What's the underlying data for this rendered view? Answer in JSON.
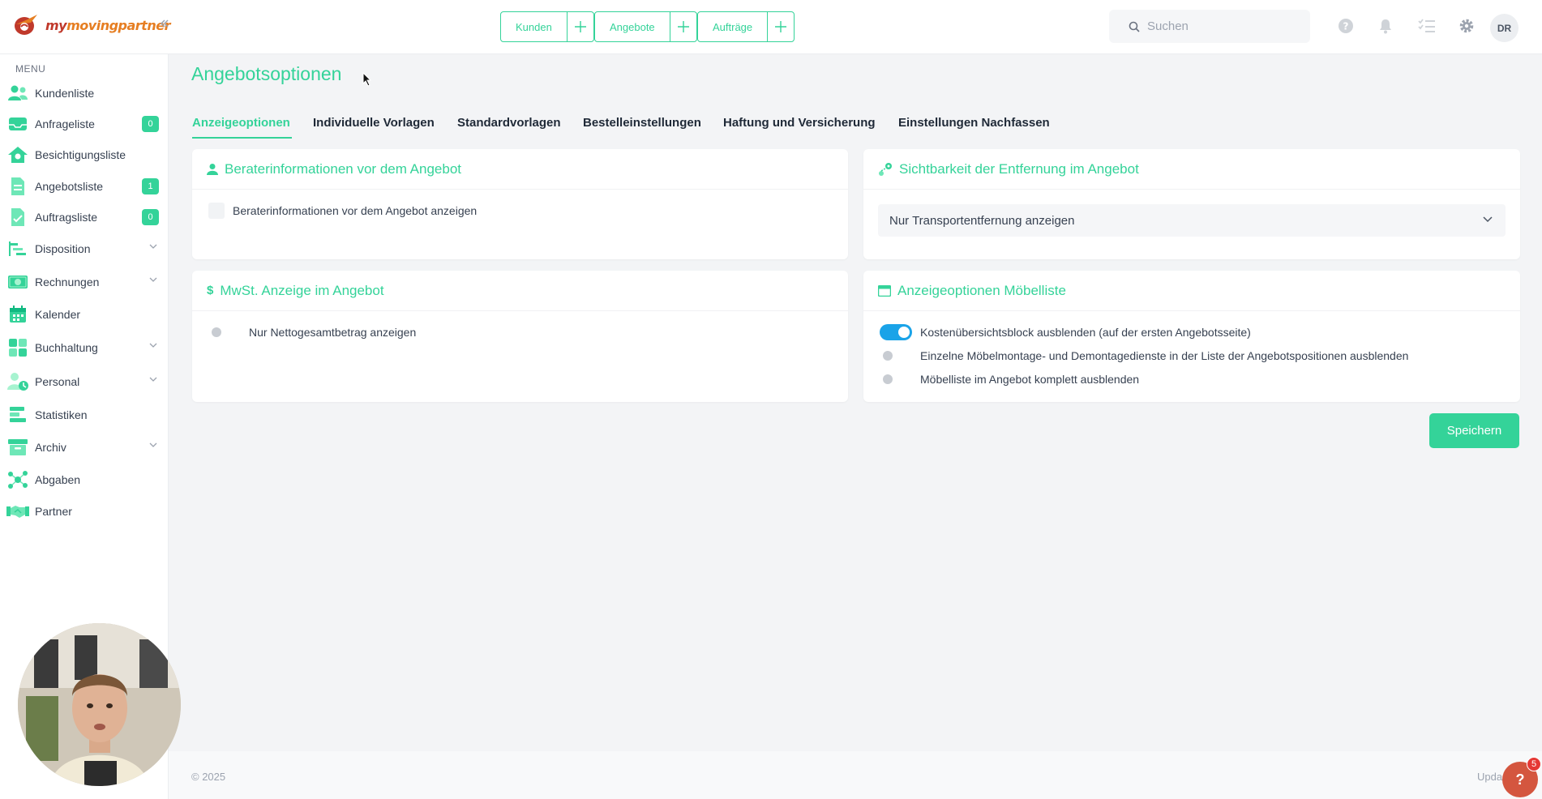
{
  "colors": {
    "accent": "#34d399",
    "toggle_on": "#1aa3e8",
    "brand_red": "#c0392b",
    "brand_orange": "#e67e22",
    "help": "#d4563f"
  },
  "header": {
    "logo_part1": "my",
    "logo_part2": "movingpartner",
    "quick_nav": [
      {
        "label": "Kunden",
        "plus_icon": "plus-icon"
      },
      {
        "label": "Angebote",
        "plus_icon": "plus-icon"
      },
      {
        "label": "Aufträge",
        "plus_icon": "plus-icon"
      }
    ],
    "search_placeholder": "Suchen",
    "icons": [
      "help-icon",
      "bell-icon",
      "task-list-icon",
      "gear-icon"
    ],
    "avatar_initials": "DR"
  },
  "sidebar": {
    "menu_label": "MENU",
    "items": [
      {
        "label": "Kundenliste",
        "icon": "customers-icon"
      },
      {
        "label": "Anfrageliste",
        "icon": "inbox-icon",
        "badge": "0"
      },
      {
        "label": "Besichtigungsliste",
        "icon": "house-icon"
      },
      {
        "label": "Angebotsliste",
        "icon": "document-icon",
        "badge": "1"
      },
      {
        "label": "Auftragsliste",
        "icon": "document-icon",
        "badge": "0"
      },
      {
        "label": "Disposition",
        "icon": "disposition-icon",
        "expandable": true
      },
      {
        "label": "Rechnungen",
        "icon": "invoice-icon",
        "expandable": true
      },
      {
        "label": "Kalender",
        "icon": "calendar-icon"
      },
      {
        "label": "Buchhaltung",
        "icon": "accounting-icon",
        "expandable": true
      },
      {
        "label": "Personal",
        "icon": "staff-icon",
        "expandable": true
      },
      {
        "label": "Statistiken",
        "icon": "statistics-icon"
      },
      {
        "label": "Archiv",
        "icon": "archive-icon",
        "expandable": true
      },
      {
        "label": "Abgaben",
        "icon": "network-icon"
      },
      {
        "label": "Partner",
        "icon": "handshake-icon"
      }
    ]
  },
  "main": {
    "title": "Angebotsoptionen",
    "tabs": [
      {
        "label": "Anzeigeoptionen",
        "active": true
      },
      {
        "label": "Individuelle Vorlagen"
      },
      {
        "label": "Standardvorlagen"
      },
      {
        "label": "Bestelleinstellungen"
      },
      {
        "label": "Haftung und Versicherung"
      },
      {
        "label": "Einstellungen Nachfassen"
      }
    ],
    "cards": {
      "berater": {
        "title": "Beraterinformationen vor dem Angebot",
        "checkbox_label": "Beraterinformationen vor dem Angebot anzeigen",
        "checked": false
      },
      "entfernung": {
        "title": "Sichtbarkeit der Entfernung im Angebot",
        "select_value": "Nur Transportentfernung anzeigen"
      },
      "mwst": {
        "title": "MwSt. Anzeige im Angebot",
        "toggle_label": "Nur Nettogesamtbetrag anzeigen",
        "toggle_on": false
      },
      "moebelliste": {
        "title": "Anzeigeoptionen Möbelliste",
        "toggles": [
          {
            "label": "Kostenübersichtsblock ausblenden (auf der ersten Angebotsseite)",
            "on": true
          },
          {
            "label": "Einzelne Möbelmontage- und Demontagedienste in der Liste der Angebotspositionen ausblenden",
            "on": false
          },
          {
            "label": "Möbelliste im Angebot komplett ausblenden",
            "on": false
          }
        ]
      }
    },
    "save_label": "Speichern"
  },
  "footer": {
    "copyright": "© 2025",
    "update_text": "Upda",
    "help_label": "?",
    "help_badge": "5"
  }
}
